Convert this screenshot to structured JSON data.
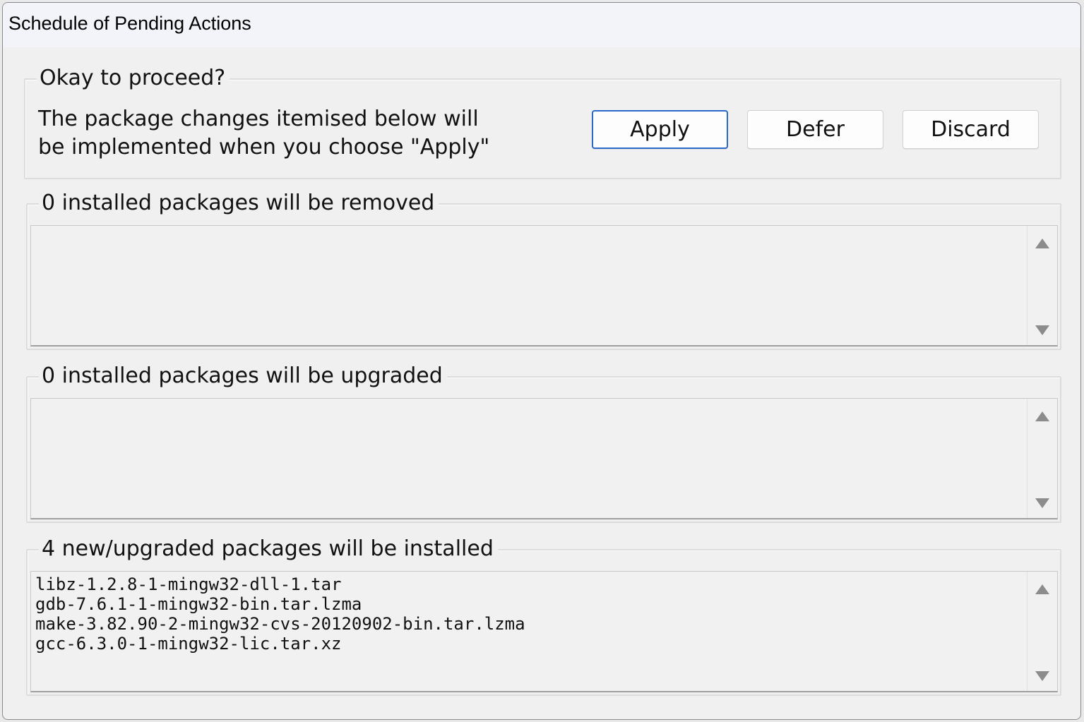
{
  "window": {
    "title": "Schedule of Pending Actions"
  },
  "confirm": {
    "legend": "Okay to proceed?",
    "line1": "The package changes itemised below will",
    "line2": "be implemented when you choose \"Apply\"",
    "buttons": {
      "apply": "Apply",
      "defer": "Defer",
      "discard": "Discard"
    }
  },
  "removed": {
    "legend": "0 installed packages will be removed",
    "items": []
  },
  "upgraded": {
    "legend": "0 installed packages will be upgraded",
    "items": []
  },
  "installed": {
    "legend": "4 new/upgraded packages will be installed",
    "items": [
      "libz-1.2.8-1-mingw32-dll-1.tar",
      "gdb-7.6.1-1-mingw32-bin.tar.lzma",
      "make-3.82.90-2-mingw32-cvs-20120902-bin.tar.lzma",
      "gcc-6.3.0-1-mingw32-lic.tar.xz"
    ]
  },
  "icons": {
    "scroll_up": "triangle-up-icon",
    "scroll_down": "triangle-down-icon"
  },
  "colors": {
    "default_button_border": "#2a69c8",
    "titlebar": "#f3f4f9",
    "background": "#f0f0f0"
  }
}
